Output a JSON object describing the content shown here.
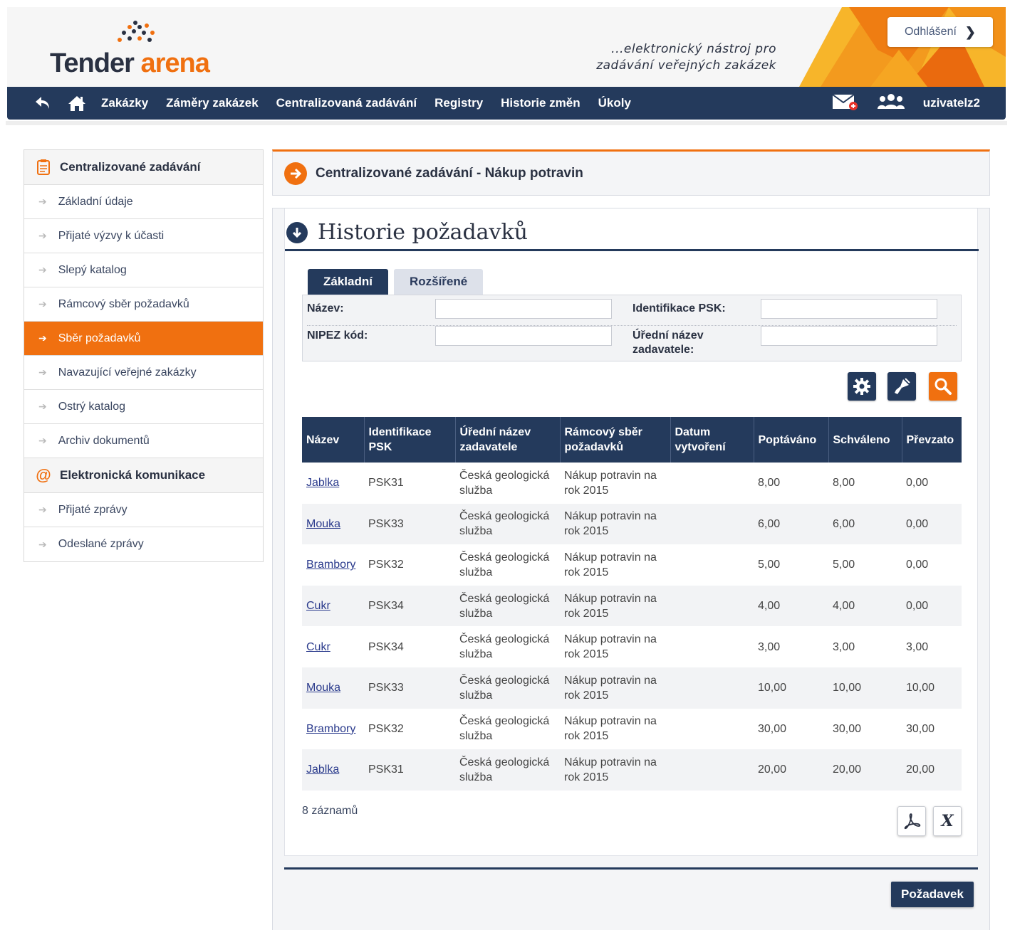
{
  "header": {
    "logo_part1": "Tender",
    "logo_part2": "arena",
    "tagline_line1": "...elektronický nástroj pro",
    "tagline_line2": "zadávání veřejných zakázek",
    "logout_label": "Odhlášení"
  },
  "nav": {
    "items": [
      "Zakázky",
      "Záměry zakázek",
      "Centralizovaná zadávání",
      "Registry",
      "Historie změn",
      "Úkoly"
    ],
    "user": "uzivatelz2"
  },
  "sidebar": {
    "section1": "Centralizované zadávání",
    "items1": [
      "Základní údaje",
      "Přijaté výzvy k účasti",
      "Slepý katalog",
      "Rámcový sběr požadavků",
      "Sběr požadavků",
      "Navazující veřejné zakázky",
      "Ostrý katalog",
      "Archiv dokumentů"
    ],
    "active_index": 4,
    "section2": "Elektronická komunikace",
    "items2": [
      "Přijaté zprávy",
      "Odeslané zprávy"
    ]
  },
  "page": {
    "title": "Centralizované zadávání - Nákup potravin",
    "heading": "Historie požadavků"
  },
  "tabs": [
    "Základní",
    "Rozšířené"
  ],
  "filter": {
    "nazev": "Název:",
    "identifikace": "Identifikace PSK:",
    "nipez": "NIPEZ kód:",
    "uredni1": "Úřední název",
    "uredni2": "zadavatele:"
  },
  "table": {
    "headers": [
      [
        "Název",
        ""
      ],
      [
        "Identifikace",
        "PSK"
      ],
      [
        "Úřední název",
        "zadavatele"
      ],
      [
        "Rámcový sběr",
        "požadavků"
      ],
      [
        "Datum",
        "vytvoření"
      ],
      [
        "Poptáváno",
        ""
      ],
      [
        "Schváleno",
        ""
      ],
      [
        "Převzato",
        ""
      ]
    ],
    "rows": [
      {
        "nazev": "Jablka",
        "psk": "PSK31",
        "zad1": "Česká geologická",
        "zad2": "služba",
        "ram1": "Nákup potravin na",
        "ram2": "rok 2015",
        "datum": "",
        "poptavano": "8,00",
        "schvaleno": "8,00",
        "prevzato": "0,00"
      },
      {
        "nazev": "Mouka",
        "psk": "PSK33",
        "zad1": "Česká geologická",
        "zad2": "služba",
        "ram1": "Nákup potravin na",
        "ram2": "rok 2015",
        "datum": "",
        "poptavano": "6,00",
        "schvaleno": "6,00",
        "prevzato": "0,00"
      },
      {
        "nazev": "Brambory",
        "psk": "PSK32",
        "zad1": "Česká geologická",
        "zad2": "služba",
        "ram1": "Nákup potravin na",
        "ram2": "rok 2015",
        "datum": "",
        "poptavano": "5,00",
        "schvaleno": "5,00",
        "prevzato": "0,00"
      },
      {
        "nazev": "Cukr",
        "psk": "PSK34",
        "zad1": "Česká geologická",
        "zad2": "služba",
        "ram1": "Nákup potravin na",
        "ram2": "rok 2015",
        "datum": "",
        "poptavano": "4,00",
        "schvaleno": "4,00",
        "prevzato": "0,00"
      },
      {
        "nazev": "Cukr",
        "psk": "PSK34",
        "zad1": "Česká geologická",
        "zad2": "služba",
        "ram1": "Nákup potravin na",
        "ram2": "rok 2015",
        "datum": "",
        "poptavano": "3,00",
        "schvaleno": "3,00",
        "prevzato": "3,00"
      },
      {
        "nazev": "Mouka",
        "psk": "PSK33",
        "zad1": "Česká geologická",
        "zad2": "služba",
        "ram1": "Nákup potravin na",
        "ram2": "rok 2015",
        "datum": "",
        "poptavano": "10,00",
        "schvaleno": "10,00",
        "prevzato": "10,00"
      },
      {
        "nazev": "Brambory",
        "psk": "PSK32",
        "zad1": "Česká geologická",
        "zad2": "služba",
        "ram1": "Nákup potravin na",
        "ram2": "rok 2015",
        "datum": "",
        "poptavano": "30,00",
        "schvaleno": "30,00",
        "prevzato": "30,00"
      },
      {
        "nazev": "Jablka",
        "psk": "PSK31",
        "zad1": "Česká geologická",
        "zad2": "služba",
        "ram1": "Nákup potravin na",
        "ram2": "rok 2015",
        "datum": "",
        "poptavano": "20,00",
        "schvaleno": "20,00",
        "prevzato": "20,00"
      }
    ],
    "count": "8 záznamů"
  },
  "export": {
    "excel_label": "X"
  },
  "action_button": "Požadavek",
  "icons": {
    "back": "back-arrow-icon",
    "home": "home-icon",
    "mail": "mail-icon",
    "users": "users-icon",
    "settings": "gear-icon",
    "clear": "brush-icon",
    "search": "search-icon",
    "pdf": "pdf-icon",
    "excel": "excel-icon"
  },
  "colors": {
    "navy": "#243a5c",
    "orange": "#f07010",
    "link": "#2a3a8c"
  }
}
